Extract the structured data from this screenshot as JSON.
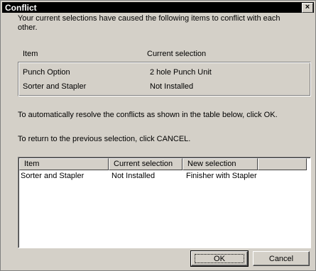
{
  "window": {
    "title": "Conflict",
    "close_glyph": "×"
  },
  "intro_text": "Your current selections have caused the following items to conflict with each other.",
  "current_table": {
    "headers": {
      "item": "Item",
      "current": "Current selection"
    },
    "rows": [
      {
        "item": "Punch Option",
        "current": "2 hole Punch Unit"
      },
      {
        "item": "Sorter and Stapler",
        "current": "Not Installed"
      }
    ]
  },
  "resolve_text": "To automatically resolve the conflicts as shown in the table below, click OK.",
  "return_text": "To return to the previous selection, click CANCEL.",
  "resolution_table": {
    "headers": {
      "item": "Item",
      "current": "Current selection",
      "new": "New selection"
    },
    "rows": [
      {
        "item": "Sorter and Stapler",
        "current": "Not Installed",
        "new": "Finisher with Stapler"
      }
    ]
  },
  "buttons": {
    "ok": "OK",
    "cancel": "Cancel"
  }
}
